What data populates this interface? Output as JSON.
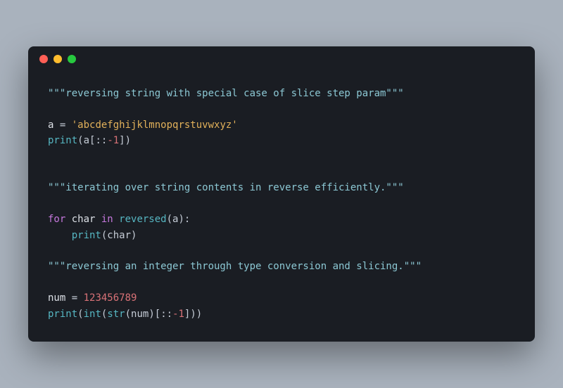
{
  "code": {
    "doc1": "\"\"\"reversing string with special case of slice step param\"\"\"",
    "a_assign_lhs": "a",
    "eq": " = ",
    "a_assign_rhs": "'abcdefghijklmnopqrstuvwxyz'",
    "print1_fn": "print",
    "print1_open": "(a[::",
    "print1_neg1": "-1",
    "print1_close": "])",
    "doc2": "\"\"\"iterating over string contents in reverse efficiently.\"\"\"",
    "for_kw": "for",
    "char_var": " char ",
    "in_kw": "in",
    "reversed_fn": " reversed",
    "reversed_args": "(a):",
    "indent": "    ",
    "print2_fn": "print",
    "print2_args": "(char)",
    "doc3": "\"\"\"reversing an integer through type conversion and slicing.\"\"\"",
    "num_lhs": "num",
    "num_val": "123456789",
    "print3_fn": "print",
    "print3_open": "(",
    "int_fn": "int",
    "int_open": "(",
    "str_fn": "str",
    "str_args": "(num)[::",
    "neg1b": "-1",
    "print3_close": "]))"
  }
}
